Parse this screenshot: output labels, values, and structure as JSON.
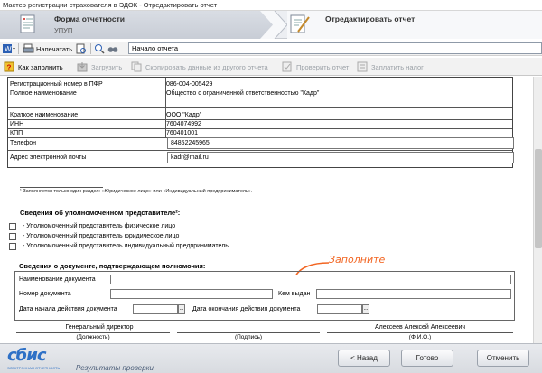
{
  "window": {
    "title": "Мастер регистрации страхователя в ЭДОК - Отредактировать отчет"
  },
  "wizard": {
    "step1_title": "Форма отчетности",
    "step1_subtitle": "УПУП",
    "step2_title": "Отредактировать отчет"
  },
  "toolbar": {
    "print_label": "Напечатать",
    "nav_value": "Начало отчета"
  },
  "actions": {
    "fill_how": "Как заполнить",
    "load": "Загрузить",
    "copy": "Скопировать данные из другого отчета",
    "check": "Проверить отчет",
    "pay_fee": "Заплатить налог"
  },
  "org": {
    "reg_label": "Регистрационный номер в ПФР",
    "reg_value": "086-004-005429",
    "full_label": "Полное наименование",
    "full_value": "Общество с ограниченной ответственностью \"Кадр\"",
    "short_label": "Краткое наименование",
    "short_value": "ООО \"Кадр\"",
    "inn_label": "ИНН",
    "inn_value": "7604074992",
    "kpp_label": "КПП",
    "kpp_value": "760401001",
    "phone_label": "Телефон",
    "phone_value": "84852245965",
    "email_label": "Адрес электронной почты",
    "email_value": "kadr@mail.ru"
  },
  "footnote": "¹ Заполняется только один раздел: «Юридическое лицо» или «Индивидуальный предприниматель».",
  "rep": {
    "title": "Сведения об уполномоченном представителе²:",
    "options": [
      "- Уполномоченный представитель физическое лицо",
      "- Уполномоченный представитель юридическое лицо",
      "- Уполномоченный представитель индивидуальный предприниматель"
    ]
  },
  "doc": {
    "title": "Сведения о документе, подтверждающем полномочия:",
    "name_label": "Наименование документа",
    "number_label": "Номер документа",
    "issued_label": "Кем выдан",
    "start_label": "Дата начала действия документа",
    "end_label": "Дата окончания действия документа",
    "dots": "..."
  },
  "annotation": "Заполните",
  "signature": {
    "position": "Генеральный директор",
    "name": "Алексеев Алексей Алексеевич",
    "cap_position": "(Должность)",
    "cap_sign": "(Подпись)",
    "cap_name": "(Ф.И.О.)"
  },
  "footer": {
    "logo": "сбис",
    "logo_sub": "ЭЛЕКТРОННАЯ ОТЧЕТНОСТЬ",
    "tagline": "Результаты проверки",
    "back": "< Назад",
    "done": "Готово",
    "cancel": "Отменить"
  },
  "colors": {
    "accent": "#2d70c6",
    "annotation": "#f26522"
  }
}
